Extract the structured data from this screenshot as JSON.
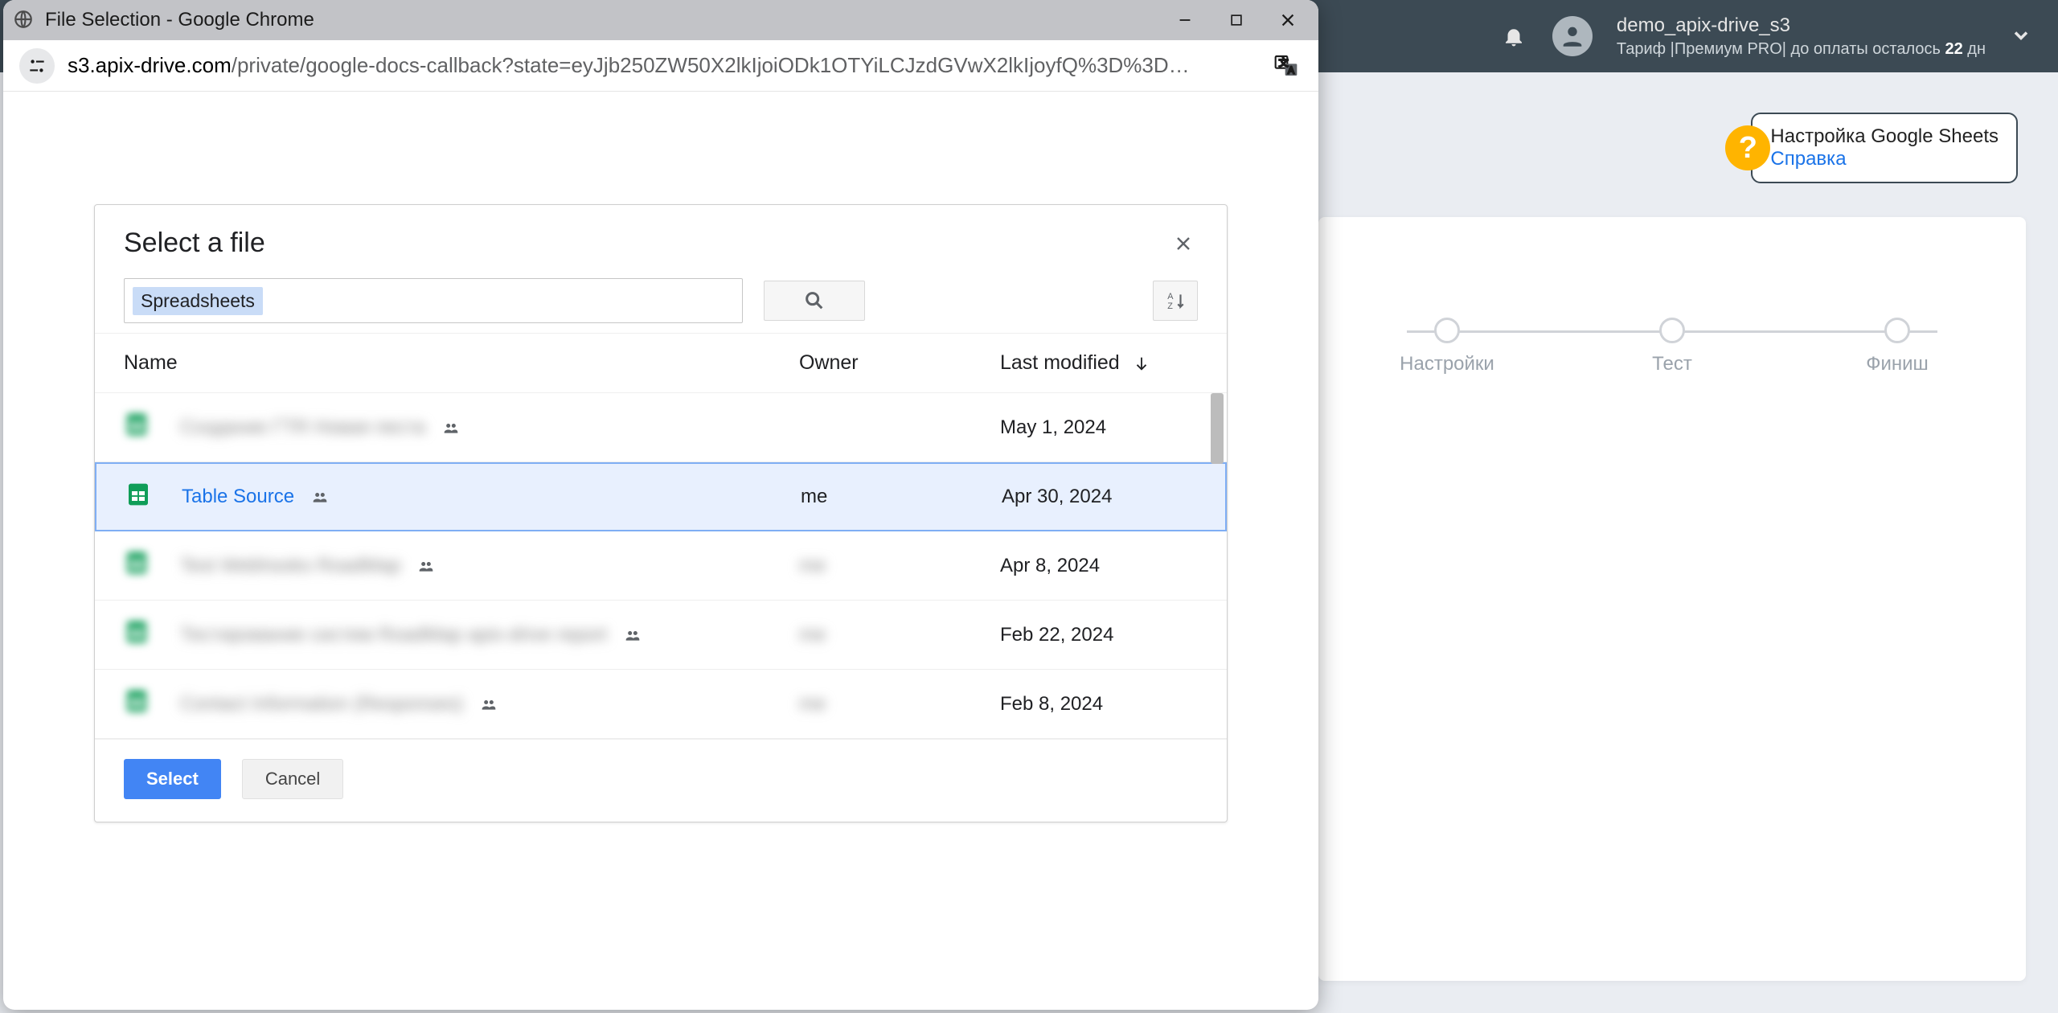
{
  "host": {
    "user": "demo_apix-drive_s3",
    "tariff_label": "Тариф |Премиум PRO| до оплаты осталось ",
    "tariff_days": "22",
    "tariff_days_suffix": " дн",
    "help_title": "Настройка Google Sheets",
    "help_link": "Справка",
    "steps": [
      "Настройки",
      "Тест",
      "Финиш"
    ]
  },
  "popup": {
    "window_title": "File Selection - Google Chrome",
    "url_host": "s3.apix-drive.com",
    "url_path": "/private/google-docs-callback?state=eyJjb250ZW50X2lkIjoiODk1OTYiLCJzdGVwX2lkIjoyfQ%3D%3D…"
  },
  "picker": {
    "title": "Select a file",
    "filter_chip": "Spreadsheets",
    "columns": {
      "name": "Name",
      "owner": "Owner",
      "modified": "Last modified"
    },
    "files": [
      {
        "name": "Создание ГTR Новая песта",
        "owner": "",
        "modified": "May 1, 2024",
        "blurred": true,
        "selected": false
      },
      {
        "name": "Table Source",
        "owner": "me",
        "modified": "Apr 30, 2024",
        "blurred": false,
        "selected": true
      },
      {
        "name": "Test Webhooks RoadMap",
        "owner": "me",
        "modified": "Apr 8, 2024",
        "blurred": true,
        "selected": false
      },
      {
        "name": "Тестирование систем RoadMap apix-drive report",
        "owner": "me",
        "modified": "Feb 22, 2024",
        "blurred": true,
        "selected": false
      },
      {
        "name": "Contact Information (Responses)",
        "owner": "me",
        "modified": "Feb 8, 2024",
        "blurred": true,
        "selected": false
      }
    ],
    "buttons": {
      "select": "Select",
      "cancel": "Cancel"
    }
  }
}
